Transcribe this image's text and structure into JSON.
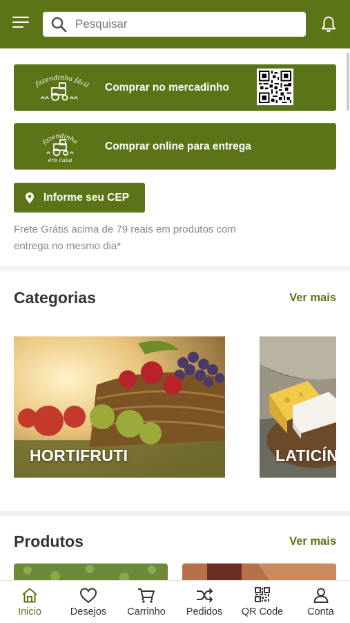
{
  "header": {
    "search_placeholder": "Pesquisar",
    "icons": {
      "menu": "menu-icon",
      "search": "search-icon",
      "notifications": "bell-icon"
    }
  },
  "actions": {
    "mercadinho": {
      "label": "Comprar no mercadinho",
      "logo_text": "fazendinha fácil"
    },
    "online": {
      "label": "Comprar online para entrega",
      "logo_text": "fazendinha em casa"
    },
    "cep_button": "Informe seu CEP",
    "frete_text": "Frete Grátis acima de 79 reais em produtos com entrega no mesmo dia*"
  },
  "categorias": {
    "title": "Categorias",
    "ver_mais": "Ver mais",
    "items": [
      {
        "label": "HORTIFRUTI"
      },
      {
        "label": "LATICÍNIOS"
      }
    ]
  },
  "produtos": {
    "title": "Produtos",
    "ver_mais": "Ver mais"
  },
  "bottom_nav": [
    {
      "label": "Inicio",
      "icon": "home-icon",
      "active": true
    },
    {
      "label": "Desejos",
      "icon": "heart-icon"
    },
    {
      "label": "Carrinho",
      "icon": "cart-icon"
    },
    {
      "label": "Pedidos",
      "icon": "shuffle-icon"
    },
    {
      "label": "QR Code",
      "icon": "qr-code-icon"
    },
    {
      "label": "Conta",
      "icon": "user-icon"
    }
  ],
  "colors": {
    "brand_green": "#5b7417",
    "text_dark": "#333333",
    "text_muted": "#888888"
  }
}
